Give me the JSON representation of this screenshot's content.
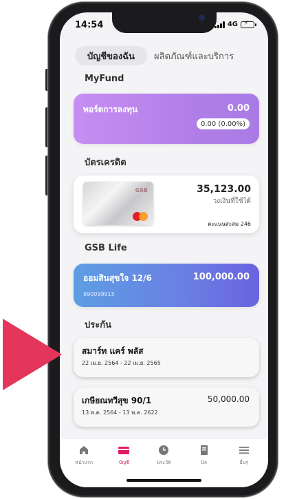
{
  "status": {
    "time": "14:54",
    "network": "4G"
  },
  "tabs": {
    "accounts": "บัญชีของฉัน",
    "products": "ผลิตภัณฑ์และบริการ"
  },
  "sections": {
    "myfund": "MyFund",
    "credit": "บัตรเครดิต",
    "life": "GSB Life",
    "insurance": "ประกัน"
  },
  "fund": {
    "name": "พอร์ตการลงทุน",
    "value": "0.00",
    "change": "0.00 (0.00%)"
  },
  "credit_card": {
    "brand": "GSB",
    "amount": "35,123.00",
    "limit_label": "วงเงินที่ใช้ได้",
    "points": "คะแนนสะสม 246"
  },
  "life": {
    "name": "ออมสินสุขใจ 12/6",
    "value": "100,000.00",
    "account_no": "990099915"
  },
  "insurance": [
    {
      "name": "สมาร์ท แคร์ พลัส",
      "period": "22 เม.ย. 2564 - 22 เม.ย. 2565",
      "value": ""
    },
    {
      "name": "เกษียณทวีสุข 90/1",
      "period": "13 พ.ค. 2564 - 13 พ.ค. 2622",
      "value": "50,000.00"
    }
  ],
  "nav": {
    "home": "หน้าแรก",
    "accounts": "บัญชี",
    "history": "ประวัติ",
    "bills": "บิล",
    "more": "อื่นๆ"
  },
  "colors": {
    "accent": "#e01a62",
    "pointer": "#e4365b",
    "fund": "#c78ef3",
    "life": "#6a7fe3"
  }
}
